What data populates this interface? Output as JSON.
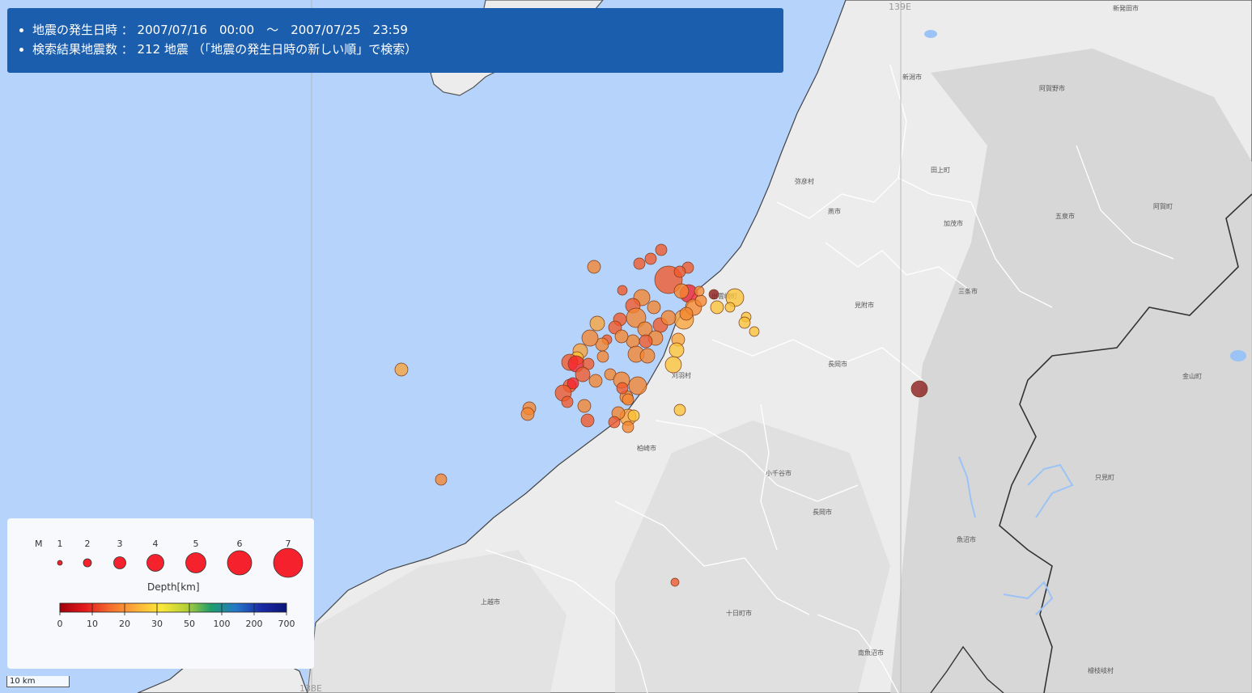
{
  "info": {
    "line1": "地震の発生日時 ： 2007/07/16　00:00　～　2007/07/25　23:59",
    "line2": "検索結果地震数 ： 212 地震 （「地震の発生日時の新しい順」で検索）"
  },
  "grid_labels": {
    "top_lon": "139E",
    "bottom_lon": "138E"
  },
  "places": [
    {
      "name": "新発田市"
    },
    {
      "name": "新潟市"
    },
    {
      "name": "阿賀野市"
    },
    {
      "name": "弥彦村"
    },
    {
      "name": "田上町"
    },
    {
      "name": "燕市"
    },
    {
      "name": "加茂市"
    },
    {
      "name": "五泉市"
    },
    {
      "name": "阿賀町"
    },
    {
      "name": "三条市"
    },
    {
      "name": "見附市"
    },
    {
      "name": "出雲崎町"
    },
    {
      "name": "長岡市"
    },
    {
      "name": "刈羽村"
    },
    {
      "name": "金山町"
    },
    {
      "name": "柏崎市"
    },
    {
      "name": "小千谷市"
    },
    {
      "name": "只見町"
    },
    {
      "name": "長岡市"
    },
    {
      "name": "魚沼市"
    },
    {
      "name": "上越市"
    },
    {
      "name": "十日町市"
    },
    {
      "name": "南魚沼市"
    },
    {
      "name": "檜枝岐村"
    }
  ],
  "earthquakes": {
    "count": 212,
    "colors": {
      "deep_red": "#8b1a1a",
      "red": "#f5222d",
      "orange_red": "#f2582a",
      "orange": "#f5862f",
      "light_orange": "#f8a43a",
      "yellow_orange": "#fbc336",
      "yellow": "#fde74a"
    }
  },
  "legend": {
    "magnitude_label": "M",
    "magnitudes": [
      "1",
      "2",
      "3",
      "4",
      "5",
      "6",
      "7"
    ],
    "depth_title": "Depth[km]",
    "depth_ticks": [
      "0",
      "10",
      "20",
      "30",
      "50",
      "100",
      "200",
      "700"
    ],
    "depth_colors": [
      "#a3000b",
      "#e41a1c",
      "#f46d2e",
      "#fdae3a",
      "#fee838",
      "#b6d136",
      "#1f9e6a",
      "#2577c9",
      "#1a2aa6",
      "#0b1678"
    ],
    "marker_color": "#f5222d"
  },
  "scale": {
    "label": "10 km"
  }
}
